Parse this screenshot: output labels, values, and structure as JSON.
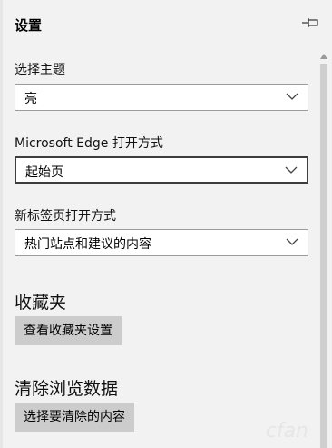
{
  "header": {
    "title": "设置",
    "pin_icon": "pin-icon"
  },
  "theme": {
    "label": "选择主题",
    "value": "亮"
  },
  "edge_open": {
    "label": "Microsoft Edge 打开方式",
    "value": "起始页"
  },
  "new_tab": {
    "label": "新标签页打开方式",
    "value": "热门站点和建议的内容"
  },
  "favorites": {
    "heading": "收藏夹",
    "button_label": "查看收藏夹设置"
  },
  "clear_data": {
    "heading": "清除浏览数据",
    "button_label": "选择要清除的内容"
  },
  "watermark": "cfan"
}
